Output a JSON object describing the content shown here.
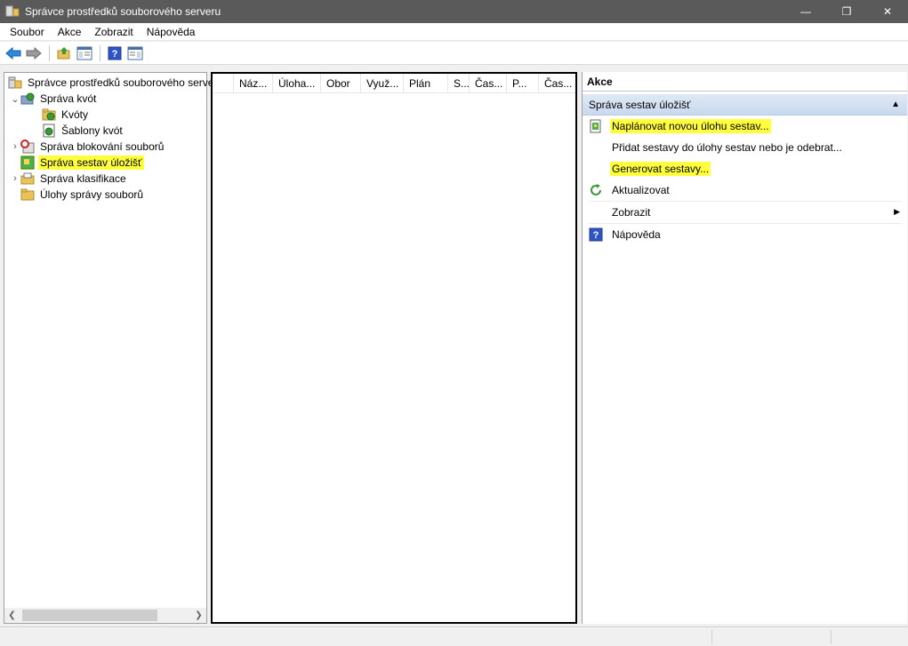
{
  "window": {
    "title": "Správce prostředků souborového serveru",
    "minimize": "—",
    "restore": "❐",
    "close": "✕"
  },
  "menu": {
    "items": [
      "Soubor",
      "Akce",
      "Zobrazit",
      "Nápověda"
    ]
  },
  "toolbar": {
    "back_icon": "back-arrow-icon",
    "forward_icon": "forward-arrow-icon",
    "up_icon": "up-folder-icon",
    "show_hide_icon": "console-tree-icon",
    "help_icon": "help-icon",
    "help_glyph": "?",
    "action_pane_icon": "action-pane-icon"
  },
  "tree": {
    "root": "Správce prostředků souborového serveru",
    "nodes": [
      {
        "label": "Správa kvót",
        "expanded": true
      },
      {
        "label": "Kvóty"
      },
      {
        "label": "Šablony kvót"
      },
      {
        "label": "Správa blokování souborů",
        "expanded": false
      },
      {
        "label": "Správa sestav úložišť",
        "selected": true
      },
      {
        "label": "Správa klasifikace",
        "expanded": false
      },
      {
        "label": "Úlohy správy souborů"
      }
    ],
    "expanded_glyph": "⌄",
    "collapsed_glyph": "›"
  },
  "list": {
    "columns": [
      "Náz...",
      "Úloha...",
      "Obor",
      "Využ...",
      "Plán",
      "S...",
      "Čas...",
      "P...",
      "Čas..."
    ]
  },
  "actions": {
    "title": "Akce",
    "section": "Správa sestav úložišť",
    "collapse_glyph": "▲",
    "items": [
      {
        "label": "Naplánovat novou úlohu sestav...",
        "highlighted": true,
        "icon": "report-task-icon"
      },
      {
        "label": "Přidat sestavy do úlohy sestav nebo je odebrat..."
      },
      {
        "label": "Generovat sestavy...",
        "highlighted": true
      },
      {
        "label": "Aktualizovat",
        "icon": "refresh-icon"
      },
      {
        "label": "Zobrazit",
        "submenu": true
      },
      {
        "label": "Nápověda",
        "icon": "help-icon"
      }
    ],
    "submenu_glyph": "▶",
    "help_glyph": "?"
  },
  "colors": {
    "titlebar": "#5a5a5a",
    "highlight": "#ffff3b",
    "section_bg": "#c9d9ee"
  }
}
